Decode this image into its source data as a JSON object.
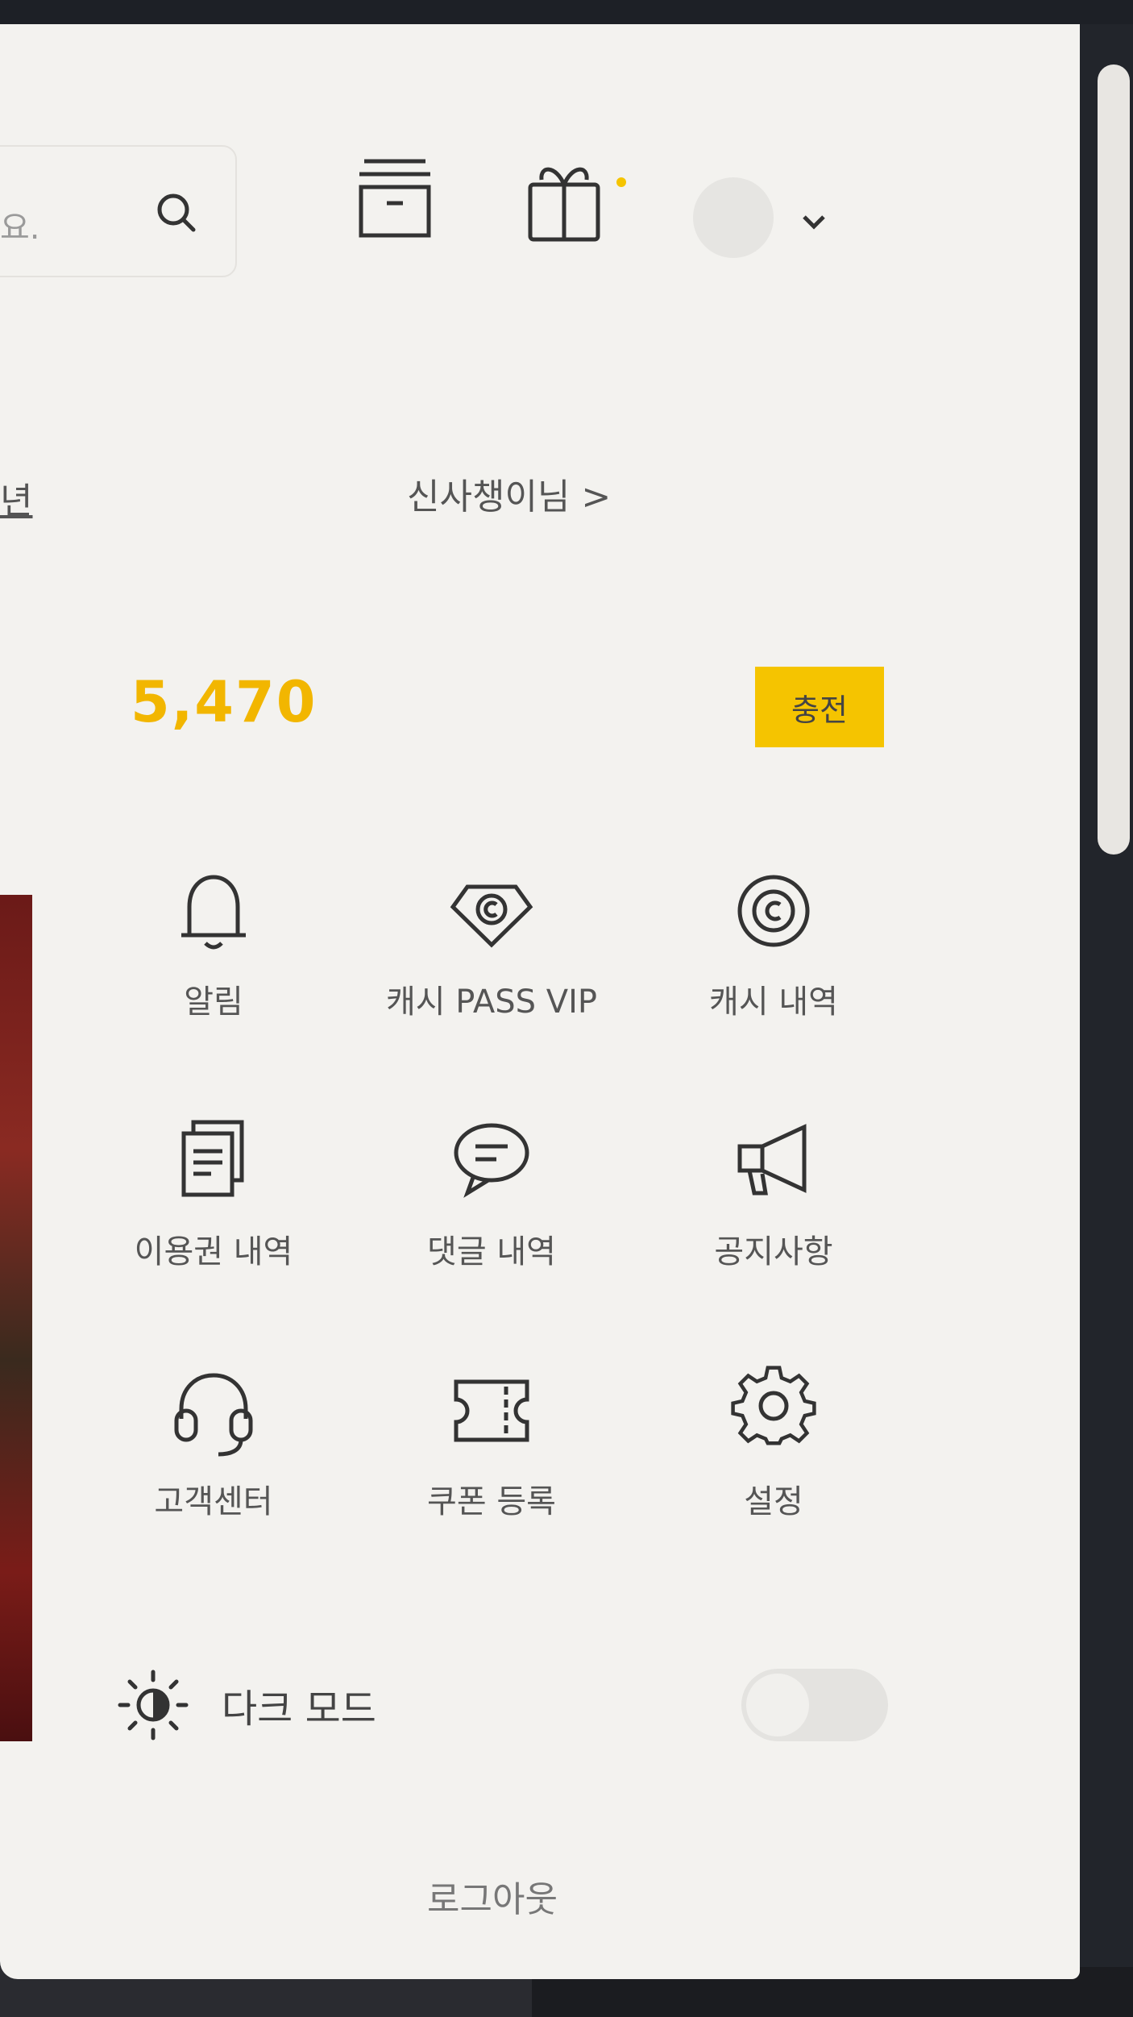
{
  "header": {
    "search_placeholder": "요.",
    "profile_dropdown": "⌄"
  },
  "profile": {
    "left_link": "년",
    "nickname": "신사챙이님 >"
  },
  "wallet": {
    "cash_amount": "5,470",
    "charge_label": "충전"
  },
  "menu": [
    {
      "label": "알림",
      "icon": "bell-icon"
    },
    {
      "label": "캐시 PASS VIP",
      "icon": "diamond-coin-icon"
    },
    {
      "label": "캐시 내역",
      "icon": "coin-icon"
    },
    {
      "label": "이용권 내역",
      "icon": "documents-icon"
    },
    {
      "label": "댓글 내역",
      "icon": "speech-bubble-icon"
    },
    {
      "label": "공지사항",
      "icon": "megaphone-icon"
    },
    {
      "label": "고객센터",
      "icon": "headset-icon"
    },
    {
      "label": "쿠폰 등록",
      "icon": "ticket-icon"
    },
    {
      "label": "설정",
      "icon": "gear-icon"
    }
  ],
  "dark_mode": {
    "label": "다크 모드",
    "enabled": false
  },
  "footer": {
    "logout_label": "로그아웃"
  },
  "colors": {
    "accent": "#f5c400",
    "cash_text": "#f2b600",
    "panel_bg": "#f3f2ef"
  }
}
